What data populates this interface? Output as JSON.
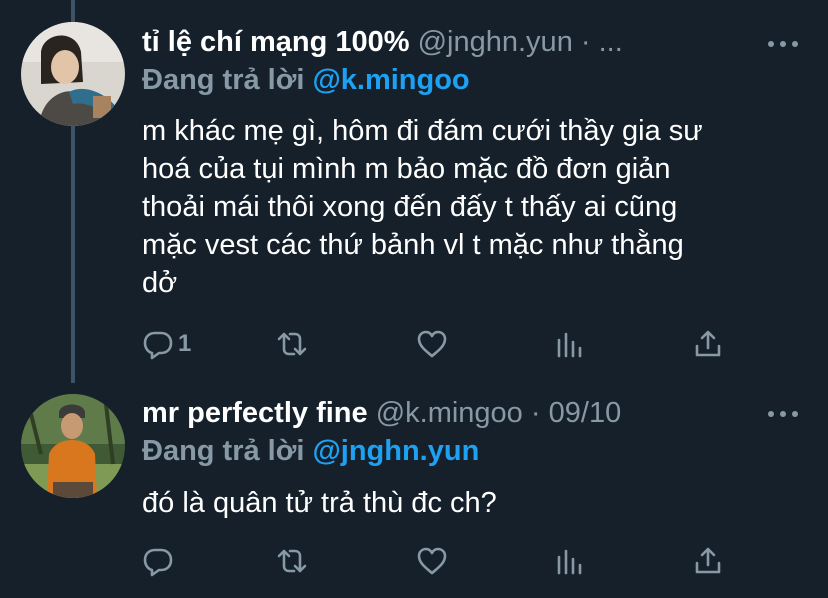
{
  "tweets": [
    {
      "display_name": "tỉ lệ chí mạng 100%",
      "handle": "@jnghn.yun",
      "separator": "·",
      "date": "...",
      "reply_prefix": "Đang trả lời",
      "reply_to": "@k.mingoo",
      "body_lines": [
        "m khác mẹ gì, hôm đi đám cưới thầy gia sư",
        "hoá của tụi mình m bảo mặc đồ đơn giản",
        "thoải mái thôi xong đến đấy t thấy ai cũng",
        "mặc vest các thứ bảnh vl t mặc như thằng",
        "dở"
      ],
      "reply_count": "1",
      "actions": [
        "reply-icon",
        "retweet-icon",
        "like-icon",
        "analytics-icon",
        "share-icon"
      ]
    },
    {
      "display_name": "mr perfectly fine",
      "handle": "@k.mingoo",
      "separator": "·",
      "date": "09/10",
      "reply_prefix": "Đang trả lời",
      "reply_to": "@jnghn.yun",
      "body_lines": [
        "đó là quân tử trả thù đc ch?"
      ],
      "reply_count": "",
      "actions": [
        "reply-icon",
        "retweet-icon",
        "like-icon",
        "analytics-icon",
        "share-icon"
      ]
    }
  ],
  "colors": {
    "background": "#15202b",
    "secondary_text": "#8899a6",
    "link": "#1da1f2",
    "thread_line": "#3d5466"
  }
}
